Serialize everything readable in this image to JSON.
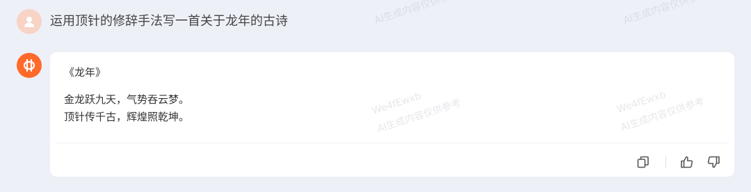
{
  "user": {
    "message": "运用顶针的修辞手法写一首关于龙年的古诗"
  },
  "assistant": {
    "title": "《龙年》",
    "lines": [
      "金龙跃九天，气势吞云梦。",
      "顶针传千古，辉煌照乾坤。"
    ]
  },
  "actions": {
    "icons": [
      "copy-icon",
      "thumbs-up-icon",
      "thumbs-down-icon"
    ]
  },
  "watermark": {
    "id": "We4fEwxb",
    "text": "AI生成内容仅供参考"
  },
  "colors": {
    "background": "#eef0f8",
    "card": "#ffffff",
    "bot_avatar": "#ff6a2b",
    "user_avatar": "#f8d4c6"
  }
}
